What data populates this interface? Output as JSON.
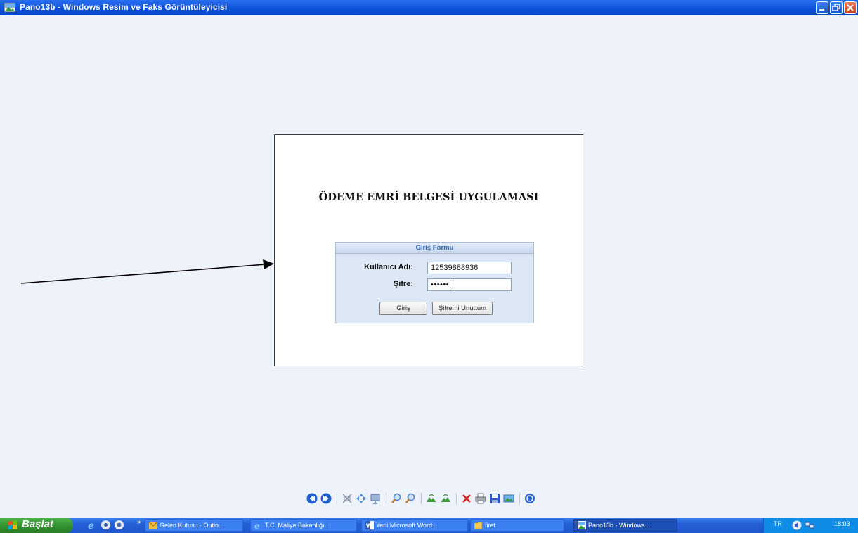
{
  "window": {
    "title": "Pano13b - Windows Resim ve Faks Görüntüleyicisi"
  },
  "document": {
    "heading": "ÖDEME EMRİ BELGESİ UYGULAMASI",
    "form": {
      "header": "Giriş Formu",
      "username_label": "Kullanıcı Adı:",
      "username_value": "12539888936",
      "password_label": "Şifre:",
      "password_value": "••••••",
      "login_button": "Giriş",
      "forgot_button": "Şifremi Unuttum"
    }
  },
  "viewer_toolbar": {
    "icons": [
      "previous-icon",
      "next-icon",
      "best-fit-icon",
      "actual-size-icon",
      "slideshow-icon",
      "zoom-in-icon",
      "zoom-out-icon",
      "rotate-clockwise-icon",
      "rotate-counterclockwise-icon",
      "delete-icon",
      "print-icon",
      "save-icon",
      "open-editor-icon",
      "help-icon"
    ]
  },
  "taskbar": {
    "start_label": "Başlat",
    "quicklaunch_more": "»",
    "tasks": [
      {
        "label": "Gelen Kutusu - Outlo...",
        "icon": "outlook-icon"
      },
      {
        "label": "T.C. Maliye Bakanlığı ...",
        "icon": "ie-icon"
      },
      {
        "label": "Yeni Microsoft Word ...",
        "icon": "word-icon"
      },
      {
        "label": "firat",
        "icon": "folder-icon"
      },
      {
        "label": "Pano13b - Windows ...",
        "icon": "image-viewer-icon",
        "active": true
      }
    ],
    "tray": {
      "language": "TR",
      "clock": "18:03"
    }
  }
}
